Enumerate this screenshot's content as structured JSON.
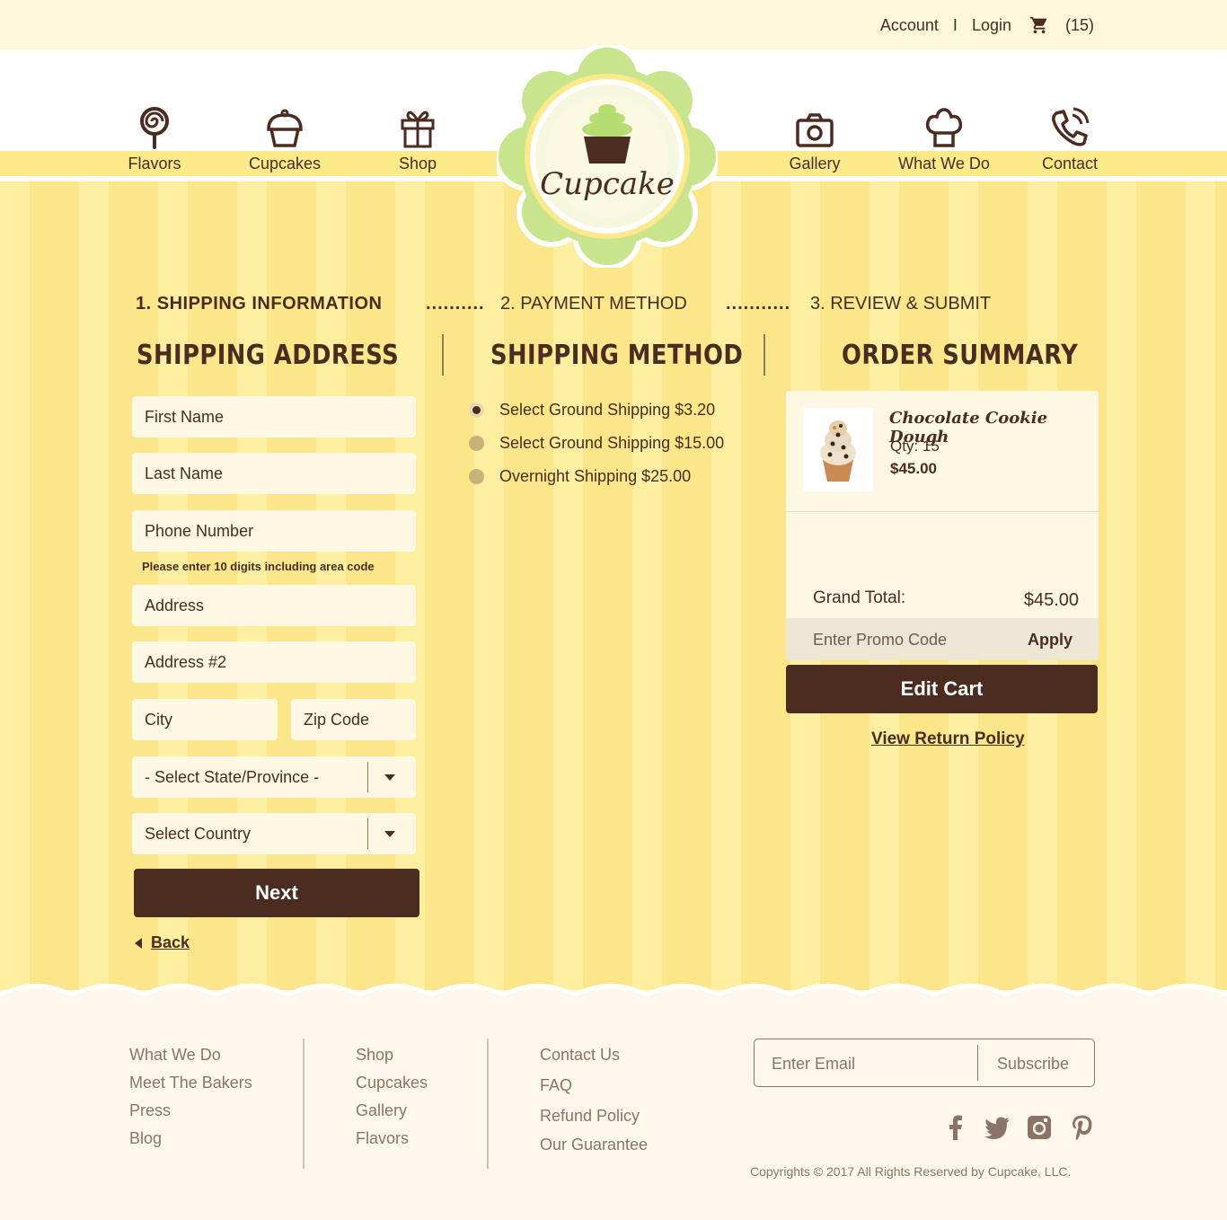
{
  "topbar": {
    "account": "Account",
    "separator": "I",
    "login": "Login",
    "cart_count": "(15)"
  },
  "nav": {
    "left": [
      {
        "label": "Flavors",
        "icon": "lollipop-icon"
      },
      {
        "label": "Cupcakes",
        "icon": "cupcake-icon"
      },
      {
        "label": "Shop",
        "icon": "gift-icon"
      }
    ],
    "right": [
      {
        "label": "Gallery",
        "icon": "camera-icon"
      },
      {
        "label": "What We Do",
        "icon": "chef-hat-icon"
      },
      {
        "label": "Contact",
        "icon": "phone-icon"
      }
    ]
  },
  "logo": {
    "text": "Cupcake"
  },
  "steps": {
    "step1": "1. SHIPPING INFORMATION",
    "dots1": "..........",
    "step2": "2. PAYMENT METHOD",
    "dots2": "...........",
    "step3": "3. REVIEW & SUBMIT"
  },
  "shipping_address": {
    "title": "SHIPPING ADDRESS",
    "first_name": "First Name",
    "last_name": "Last Name",
    "phone": "Phone Number",
    "phone_hint": "Please enter 10 digits including area code",
    "address": "Address",
    "address2": "Address #2",
    "city": "City",
    "zip": "Zip Code",
    "state": "- Select State/Province -",
    "country": "Select Country",
    "next": "Next",
    "back": "Back"
  },
  "shipping_method": {
    "title": "SHIPPING METHOD",
    "options": [
      {
        "label": "Select Ground Shipping $3.20",
        "selected": true
      },
      {
        "label": "Select Ground Shipping $15.00",
        "selected": false
      },
      {
        "label": "Overnight Shipping $25.00",
        "selected": false
      }
    ]
  },
  "order_summary": {
    "title": "ORDER SUMMARY",
    "product_name": "Chocolate Cookie Dough",
    "qty": "Qty: 15",
    "price": "$45.00",
    "grand_total_label": "Grand Total:",
    "grand_total_value": "$45.00",
    "promo_placeholder": "Enter Promo Code",
    "apply": "Apply",
    "edit_cart": "Edit Cart",
    "return_policy": "View Return Policy"
  },
  "footer": {
    "col1": [
      "What We Do",
      "Meet The Bakers",
      "Press",
      "Blog"
    ],
    "col2": [
      "Shop",
      "Cupcakes",
      "Gallery",
      "Flavors"
    ],
    "col3": [
      "Contact Us",
      "FAQ",
      "Refund Policy",
      "Our Guarantee"
    ],
    "email_placeholder": "Enter Email",
    "subscribe": "Subscribe",
    "social": [
      "facebook-icon",
      "twitter-icon",
      "instagram-icon",
      "pinterest-icon"
    ],
    "copyright": "Copyrights © 2017 All Rights Reserved by Cupcake, LLC."
  },
  "colors": {
    "brown": "#4a2c21",
    "yellow": "#fbe78a",
    "green": "#c8e58e",
    "cream": "#fdf8e3"
  }
}
